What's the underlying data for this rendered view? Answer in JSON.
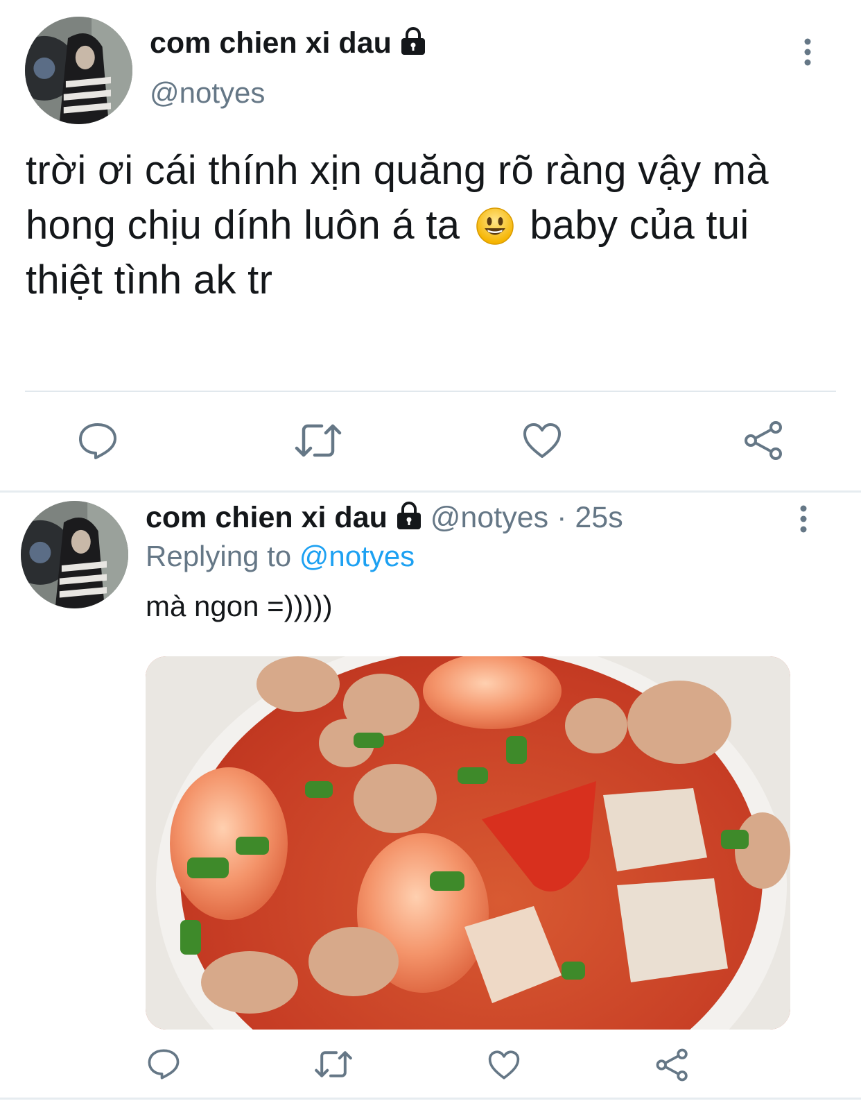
{
  "main_tweet": {
    "display_name": "com chien xi dau",
    "handle": "@notyes",
    "text_before_emoji": "trời ơi cái thính xịn quăng rõ ràng vậy mà hong chịu dính luôn á ta",
    "emoji": "smiley-emoji",
    "text_after_emoji": "baby của tui thiệt tình ak tr",
    "actions": [
      "reply-icon",
      "retweet-icon",
      "like-icon",
      "share-icon"
    ]
  },
  "reply_tweet": {
    "display_name": "com chien xi dau",
    "handle": "@notyes",
    "separator": "·",
    "time": "25s",
    "replying_label": "Replying to",
    "replying_handle": "@notyes",
    "text": "mà ngon =)))))",
    "media": "photo-of-shrimp-and-pork-noodle-soup",
    "actions": [
      "reply-icon",
      "retweet-icon",
      "like-icon",
      "share-icon"
    ]
  },
  "colors": {
    "text": "#14171a",
    "muted": "#657786",
    "link": "#1da1f2",
    "icon": "#657786",
    "divider": "#e1e8ed"
  }
}
